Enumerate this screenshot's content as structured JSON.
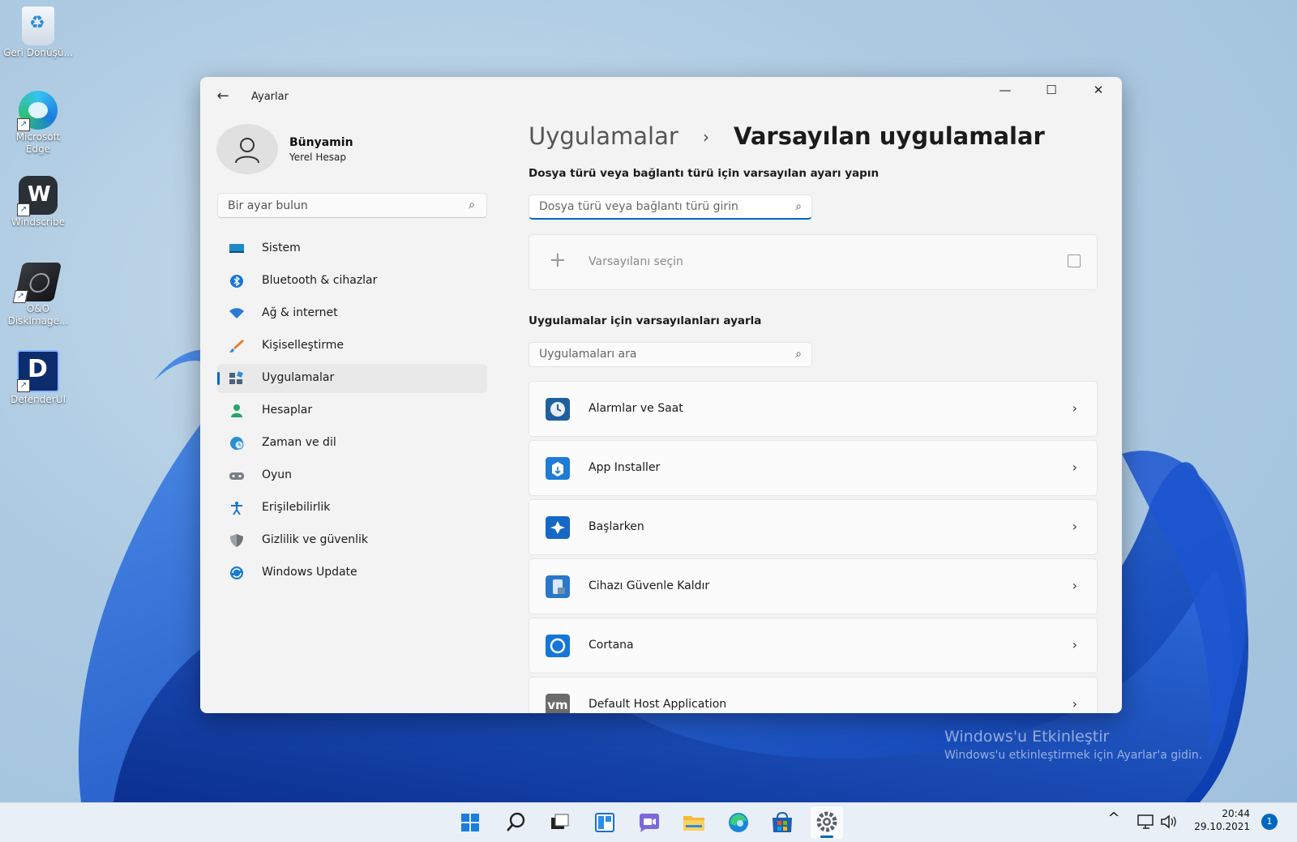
{
  "desktop": {
    "icons": [
      {
        "label": "Geri Dönüşü..."
      },
      {
        "label": "Microsoft Edge"
      },
      {
        "label": "Windscribe"
      },
      {
        "label": "O&O DiskImage..."
      },
      {
        "label": "DefenderUI"
      }
    ],
    "watermark": {
      "title": "Windows'u Etkinleştir",
      "subtitle": "Windows'u etkinleştirmek için Ayarlar'a gidin."
    }
  },
  "window": {
    "title": "Ayarlar",
    "back_glyph": "←",
    "minimize_glyph": "—",
    "maximize_glyph": "☐",
    "close_glyph": "✕"
  },
  "profile": {
    "name": "Bünyamin",
    "account_type": "Yerel Hesap"
  },
  "sidebar": {
    "search_placeholder": "Bir ayar bulun",
    "items": [
      {
        "label": "Sistem",
        "icon": "monitor-icon",
        "color": "#1e88c8"
      },
      {
        "label": "Bluetooth & cihazlar",
        "icon": "bluetooth-icon",
        "color": "#1b76d2"
      },
      {
        "label": "Ağ & internet",
        "icon": "wifi-icon",
        "color": "#2a7ad6"
      },
      {
        "label": "Kişiselleştirme",
        "icon": "brush-icon",
        "color": "#e47b2d"
      },
      {
        "label": "Uygulamalar",
        "icon": "apps-icon",
        "color": "#4a6380",
        "active": true
      },
      {
        "label": "Hesaplar",
        "icon": "person-icon",
        "color": "#26a66a"
      },
      {
        "label": "Zaman ve dil",
        "icon": "globe-clock-icon",
        "color": "#2b8ed4"
      },
      {
        "label": "Oyun",
        "icon": "gamepad-icon",
        "color": "#7a7f87"
      },
      {
        "label": "Erişilebilirlik",
        "icon": "accessibility-icon",
        "color": "#1676cf"
      },
      {
        "label": "Gizlilik ve güvenlik",
        "icon": "shield-icon",
        "color": "#6f737a"
      },
      {
        "label": "Windows Update",
        "icon": "update-icon",
        "color": "#1a7bd0"
      }
    ]
  },
  "main": {
    "breadcrumb_parent": "Uygulamalar",
    "breadcrumb_separator": "›",
    "breadcrumb_current": "Varsayılan uygulamalar",
    "filetype_heading": "Dosya türü veya bağlantı türü için varsayılan ayarı yapın",
    "filetype_search_placeholder": "Dosya türü veya bağlantı türü girin",
    "choose_default_label": "Varsayılanı seçin",
    "apps_heading": "Uygulamalar için varsayılanları ayarla",
    "apps_search_placeholder": "Uygulamaları ara",
    "apps": [
      {
        "name": "Alarmlar ve Saat",
        "icon": "alarm-clock-icon",
        "color": "#1f5f9e"
      },
      {
        "name": "App Installer",
        "icon": "package-icon",
        "color": "#1e7bd6"
      },
      {
        "name": "Başlarken",
        "icon": "tips-icon",
        "color": "#1668c4"
      },
      {
        "name": "Cihazı Güvenle Kaldır",
        "icon": "usb-eject-icon",
        "color": "#2a78c8"
      },
      {
        "name": "Cortana",
        "icon": "cortana-icon",
        "color": "#1576d8"
      },
      {
        "name": "Default Host Application",
        "icon": "vm-icon",
        "color": "#6b6b6b",
        "icon_text": "vm"
      }
    ]
  },
  "taskbar": {
    "apps": [
      {
        "icon": "start-icon"
      },
      {
        "icon": "search-icon"
      },
      {
        "icon": "task-view-icon"
      },
      {
        "icon": "widgets-icon"
      },
      {
        "icon": "chat-icon"
      },
      {
        "icon": "file-explorer-icon"
      },
      {
        "icon": "edge-icon"
      },
      {
        "icon": "store-icon"
      },
      {
        "icon": "settings-icon",
        "active": true
      }
    ],
    "tray": {
      "chevron_glyph": "^",
      "time": "20:44",
      "date": "29.10.2021",
      "notification_count": "1"
    }
  }
}
